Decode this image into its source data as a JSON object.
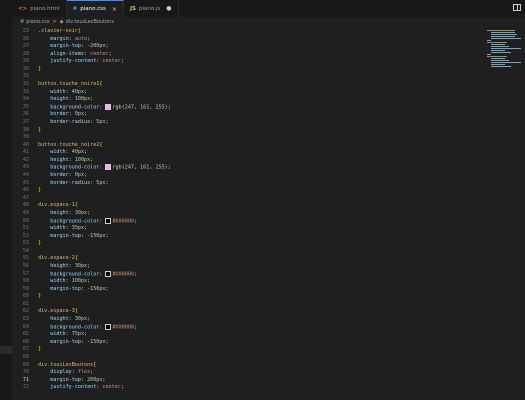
{
  "tabs": [
    {
      "icon": "<>",
      "label": "piano.html",
      "active": false
    },
    {
      "icon": "#",
      "label": "piano.css",
      "active": true,
      "close": "×"
    },
    {
      "icon": "JS",
      "label": "piano.js",
      "active": false,
      "modified": "●"
    }
  ],
  "breadcrumb": {
    "file": "piano.css",
    "separator": ">",
    "selector": "div.tousLesBoutons"
  },
  "lines": [
    {
      "n": "23",
      "tokens": [
        [
          "sel",
          ".clavier-noir{"
        ]
      ]
    },
    {
      "n": "26",
      "tokens": [
        [
          "prop",
          "    margin"
        ],
        [
          "punc",
          ": "
        ],
        [
          "val",
          "auto"
        ],
        [
          "punc",
          ";"
        ]
      ]
    },
    {
      "n": "27",
      "tokens": [
        [
          "prop",
          "    margin-top"
        ],
        [
          "punc",
          ": "
        ],
        [
          "num",
          "-200px"
        ],
        [
          "punc",
          ";"
        ]
      ]
    },
    {
      "n": "28",
      "tokens": [
        [
          "prop",
          "    align-items"
        ],
        [
          "punc",
          ": "
        ],
        [
          "val",
          "center"
        ],
        [
          "punc",
          ";"
        ]
      ]
    },
    {
      "n": "29",
      "tokens": [
        [
          "prop",
          "    justify-content"
        ],
        [
          "punc",
          ": "
        ],
        [
          "val",
          "center"
        ],
        [
          "punc",
          ";"
        ]
      ]
    },
    {
      "n": "30",
      "tokens": [
        [
          "brace",
          "}"
        ]
      ]
    },
    {
      "n": "31",
      "tokens": []
    },
    {
      "n": "32",
      "tokens": [
        [
          "sel",
          "button.touche_noire1"
        ],
        [
          "brace",
          "{"
        ]
      ]
    },
    {
      "n": "33",
      "tokens": [
        [
          "prop",
          "    width"
        ],
        [
          "punc",
          ": "
        ],
        [
          "num",
          "40px"
        ],
        [
          "punc",
          ";"
        ]
      ]
    },
    {
      "n": "34",
      "tokens": [
        [
          "prop",
          "    height"
        ],
        [
          "punc",
          ": "
        ],
        [
          "num",
          "100px"
        ],
        [
          "punc",
          ";"
        ]
      ]
    },
    {
      "n": "35",
      "tokens": [
        [
          "prop",
          "    background-color"
        ],
        [
          "punc",
          ": "
        ],
        [
          "swatch",
          "#f7a5ff"
        ],
        [
          "fn",
          "rgb"
        ],
        [
          "punc",
          "("
        ],
        [
          "num",
          "247"
        ],
        [
          "punc",
          ", "
        ],
        [
          "num",
          "161"
        ],
        [
          "punc",
          ", "
        ],
        [
          "num",
          "255"
        ],
        [
          "punc",
          ");"
        ]
      ]
    },
    {
      "n": "36",
      "tokens": [
        [
          "prop",
          "    border"
        ],
        [
          "punc",
          ": "
        ],
        [
          "num",
          "0px"
        ],
        [
          "punc",
          ";"
        ]
      ]
    },
    {
      "n": "37",
      "tokens": [
        [
          "prop",
          "    border-radius"
        ],
        [
          "punc",
          ": "
        ],
        [
          "num",
          "5px"
        ],
        [
          "punc",
          ";"
        ]
      ]
    },
    {
      "n": "38",
      "tokens": [
        [
          "brace",
          "}"
        ]
      ]
    },
    {
      "n": "39",
      "tokens": []
    },
    {
      "n": "40",
      "tokens": [
        [
          "sel",
          "button.touche_noire2"
        ],
        [
          "brace",
          "{"
        ]
      ]
    },
    {
      "n": "41",
      "tokens": [
        [
          "prop",
          "    width"
        ],
        [
          "punc",
          ": "
        ],
        [
          "num",
          "40px"
        ],
        [
          "punc",
          ";"
        ]
      ]
    },
    {
      "n": "42",
      "tokens": [
        [
          "prop",
          "    height"
        ],
        [
          "punc",
          ": "
        ],
        [
          "num",
          "100px"
        ],
        [
          "punc",
          ";"
        ]
      ]
    },
    {
      "n": "43",
      "tokens": [
        [
          "prop",
          "    background-color"
        ],
        [
          "punc",
          ": "
        ],
        [
          "swatch",
          "#f7a5ff"
        ],
        [
          "fn",
          "rgb"
        ],
        [
          "punc",
          "("
        ],
        [
          "num",
          "247"
        ],
        [
          "punc",
          ", "
        ],
        [
          "num",
          "161"
        ],
        [
          "punc",
          ", "
        ],
        [
          "num",
          "255"
        ],
        [
          "punc",
          ");"
        ]
      ]
    },
    {
      "n": "44",
      "tokens": [
        [
          "prop",
          "    border"
        ],
        [
          "punc",
          ": "
        ],
        [
          "num",
          "0px"
        ],
        [
          "punc",
          ";"
        ]
      ]
    },
    {
      "n": "45",
      "tokens": [
        [
          "prop",
          "    border-radius"
        ],
        [
          "punc",
          ": "
        ],
        [
          "num",
          "5px"
        ],
        [
          "punc",
          ";"
        ]
      ]
    },
    {
      "n": "46",
      "tokens": [
        [
          "brace",
          "}"
        ]
      ]
    },
    {
      "n": "47",
      "tokens": []
    },
    {
      "n": "48",
      "tokens": [
        [
          "sel",
          "div.espace-1"
        ],
        [
          "brace",
          "{"
        ]
      ]
    },
    {
      "n": "49",
      "tokens": [
        [
          "prop",
          "    height"
        ],
        [
          "punc",
          ": "
        ],
        [
          "num",
          "30px"
        ],
        [
          "punc",
          ";"
        ]
      ]
    },
    {
      "n": "50",
      "tokens": [
        [
          "prop",
          "    background-color"
        ],
        [
          "punc",
          ": "
        ],
        [
          "swatch",
          "#000000"
        ],
        [
          "val",
          "#000000"
        ],
        [
          "punc",
          ";"
        ]
      ]
    },
    {
      "n": "51",
      "tokens": [
        [
          "prop",
          "    width"
        ],
        [
          "punc",
          ": "
        ],
        [
          "num",
          "35px"
        ],
        [
          "punc",
          ";"
        ]
      ]
    },
    {
      "n": "52",
      "tokens": [
        [
          "prop",
          "    margin-top"
        ],
        [
          "punc",
          ": "
        ],
        [
          "num",
          "-150px"
        ],
        [
          "punc",
          ";"
        ]
      ]
    },
    {
      "n": "53",
      "tokens": [
        [
          "brace",
          "}"
        ]
      ]
    },
    {
      "n": "54",
      "tokens": []
    },
    {
      "n": "55",
      "tokens": [
        [
          "sel",
          "div.espace-2"
        ],
        [
          "brace",
          "{"
        ]
      ]
    },
    {
      "n": "56",
      "tokens": [
        [
          "prop",
          "    height"
        ],
        [
          "punc",
          ": "
        ],
        [
          "num",
          "30px"
        ],
        [
          "punc",
          ";"
        ]
      ]
    },
    {
      "n": "57",
      "tokens": [
        [
          "prop",
          "    background-color"
        ],
        [
          "punc",
          ": "
        ],
        [
          "swatch",
          "#000000"
        ],
        [
          "val",
          "#000000"
        ],
        [
          "punc",
          ";"
        ]
      ]
    },
    {
      "n": "58",
      "tokens": [
        [
          "prop",
          "    width"
        ],
        [
          "punc",
          ": "
        ],
        [
          "num",
          "100px"
        ],
        [
          "punc",
          ";"
        ]
      ]
    },
    {
      "n": "59",
      "tokens": [
        [
          "prop",
          "    margin-top"
        ],
        [
          "punc",
          ": "
        ],
        [
          "num",
          "-150px"
        ],
        [
          "punc",
          ";"
        ]
      ]
    },
    {
      "n": "60",
      "tokens": [
        [
          "brace",
          "}"
        ]
      ]
    },
    {
      "n": "61",
      "tokens": []
    },
    {
      "n": "62",
      "tokens": [
        [
          "sel",
          "div.espace-3"
        ],
        [
          "brace",
          "{"
        ]
      ]
    },
    {
      "n": "63",
      "tokens": [
        [
          "prop",
          "    height"
        ],
        [
          "punc",
          ": "
        ],
        [
          "num",
          "30px"
        ],
        [
          "punc",
          ";"
        ]
      ]
    },
    {
      "n": "64",
      "tokens": [
        [
          "prop",
          "    background-color"
        ],
        [
          "punc",
          ": "
        ],
        [
          "swatch",
          "#000000"
        ],
        [
          "val",
          "#000000"
        ],
        [
          "punc",
          ";"
        ]
      ]
    },
    {
      "n": "65",
      "tokens": [
        [
          "prop",
          "    width"
        ],
        [
          "punc",
          ": "
        ],
        [
          "num",
          "75px"
        ],
        [
          "punc",
          ";"
        ]
      ]
    },
    {
      "n": "66",
      "tokens": [
        [
          "prop",
          "    margin-top"
        ],
        [
          "punc",
          ": "
        ],
        [
          "num",
          "-150px"
        ],
        [
          "punc",
          ";"
        ]
      ]
    },
    {
      "n": "67",
      "tokens": [
        [
          "brace",
          "}"
        ]
      ]
    },
    {
      "n": "68",
      "tokens": []
    },
    {
      "n": "69",
      "tokens": [
        [
          "sel",
          "div.tousLesBoutons"
        ],
        [
          "brace",
          "{"
        ]
      ]
    },
    {
      "n": "70",
      "tokens": [
        [
          "prop",
          "    display"
        ],
        [
          "punc",
          ": "
        ],
        [
          "val",
          "flex"
        ],
        [
          "punc",
          ";"
        ]
      ]
    },
    {
      "n": "71",
      "tokens": [
        [
          "prop",
          "    margin-top"
        ],
        [
          "punc",
          ": "
        ],
        [
          "num",
          "200px"
        ],
        [
          "punc",
          ";"
        ]
      ],
      "current": true
    },
    {
      "n": "72",
      "tokens": [
        [
          "prop",
          "    justify-content"
        ],
        [
          "punc",
          ": "
        ],
        [
          "val",
          "center"
        ],
        [
          "punc",
          ";"
        ]
      ]
    }
  ]
}
